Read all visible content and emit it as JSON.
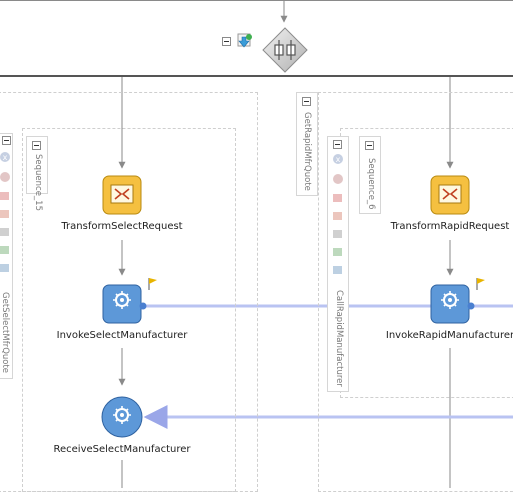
{
  "scopes": {
    "outer_left": "GetSelectMfrQuote",
    "outer_right": "GetRapidMfrQuote",
    "seq_left": "Sequence_15",
    "seq_right": "Sequence_6"
  },
  "activities": {
    "transform_select": "TransformSelectRequest",
    "invoke_select": "InvokeSelectManufacturer",
    "receive_select": "ReceiveSelectManufacturer",
    "transform_rapid": "TransformRapidRequest",
    "invoke_rapid": "InvokeRapidManufacturer",
    "call_rapid": "CallRapidManufacturer"
  },
  "icons": {
    "flow_gateway": "flow-diamond-icon",
    "transform": "transform-icon",
    "invoke": "invoke-gear-icon",
    "receive": "receive-gear-icon",
    "flag": "flag-icon",
    "collapse": "collapse-icon",
    "expand": "expand-arrow-icon"
  },
  "colors": {
    "partner_link": "#b9c3f2",
    "flow_line": "#8a8a8a",
    "scope_border": "#c8c8c8",
    "transform_fill": "#f5c040",
    "invoke_fill": "#5d98d8",
    "flag": "#e8b400"
  }
}
